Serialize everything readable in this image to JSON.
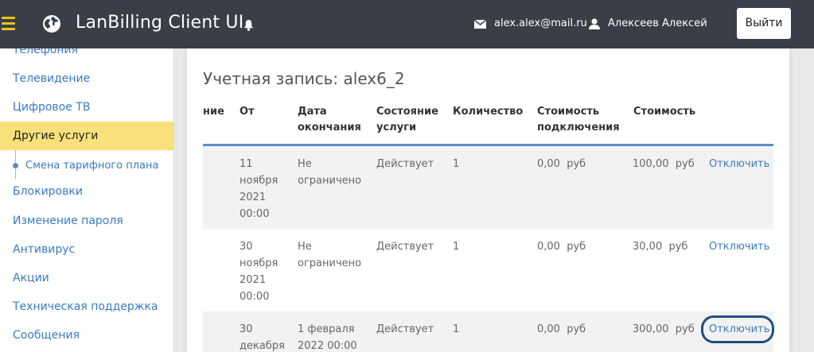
{
  "header": {
    "app_title": "LanBilling Client UI",
    "email": "alex.alex@mail.ru",
    "username": "Алексеев Алексей",
    "logout_label": "Выйти"
  },
  "sidebar": {
    "items": [
      {
        "label": "Телефония"
      },
      {
        "label": "Телевидение"
      },
      {
        "label": "Цифровое ТВ"
      },
      {
        "label": "Другие услуги",
        "active": true
      },
      {
        "label": "Смена тарифного плана",
        "sub": true
      },
      {
        "label": "Блокировки"
      },
      {
        "label": "Изменение пароля"
      },
      {
        "label": "Антивирус"
      },
      {
        "label": "Акции"
      },
      {
        "label": "Техническая поддержка"
      },
      {
        "label": "Сообщения"
      }
    ]
  },
  "main": {
    "account_title": "Учетная запись: alex6_2",
    "columns": {
      "name_tail": "ние",
      "from": "От",
      "end_date": "Дата окончания",
      "state": "Состояние услуги",
      "qty": "Количество",
      "conn_cost": "Стоимость подключения",
      "cost": "Стоимость"
    },
    "rows": [
      {
        "from": "11 ноября 2021 00:00",
        "end": "Не ограничено",
        "state": "Действует",
        "qty": "1",
        "conn_cost": "0,00  руб",
        "cost": "100,00  руб",
        "action": "Отключить"
      },
      {
        "from": "30 ноября 2021 00:00",
        "end": "Не ограничено",
        "state": "Действует",
        "qty": "1",
        "conn_cost": "0,00  руб",
        "cost": "30,00  руб",
        "action": "Отключить"
      },
      {
        "from": "30 декабря",
        "end": "1 февраля 2022 00:00",
        "state": "Действует",
        "qty": "1",
        "conn_cost": "0,00  руб",
        "cost": "300,00  руб",
        "action": "Отключить"
      }
    ]
  },
  "colors": {
    "header_bg": "#3a3e48",
    "accent_yellow": "#f0c419",
    "active_item_bg": "#f9e07a",
    "link_blue": "#3a7bbf",
    "table_rule": "#5a8ecb",
    "focus_ring": "#1f4f82"
  },
  "icons": [
    "menu-icon",
    "globe-icon",
    "bell-icon",
    "mail-icon",
    "user-icon"
  ]
}
